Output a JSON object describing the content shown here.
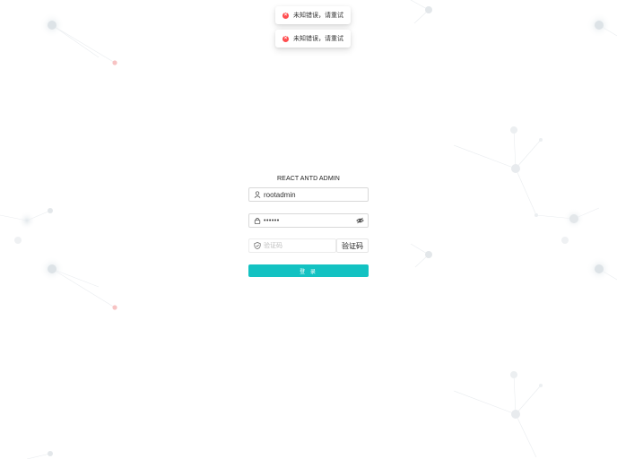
{
  "notifications": [
    {
      "text": "未知错误，请重试",
      "icon": "error-circle-icon"
    },
    {
      "text": "未知错误，请重试",
      "icon": "error-circle-icon"
    }
  ],
  "login": {
    "title": "REACT ANTD ADMIN",
    "username_value": "rootadmin",
    "password_mask": "••••••",
    "captcha_placeholder": "验证码",
    "captcha_button_label": "验证码",
    "submit_label": "登 录"
  },
  "icons": {
    "username": "user-icon",
    "password": "lock-icon",
    "password_toggle": "eye-invisible-icon",
    "captcha": "safety-shield-icon"
  },
  "colors": {
    "primary": "#13c2c2",
    "error": "#ff4d4f",
    "particles": "#e6e9ec",
    "accent_particle": "#f7c3c3"
  }
}
